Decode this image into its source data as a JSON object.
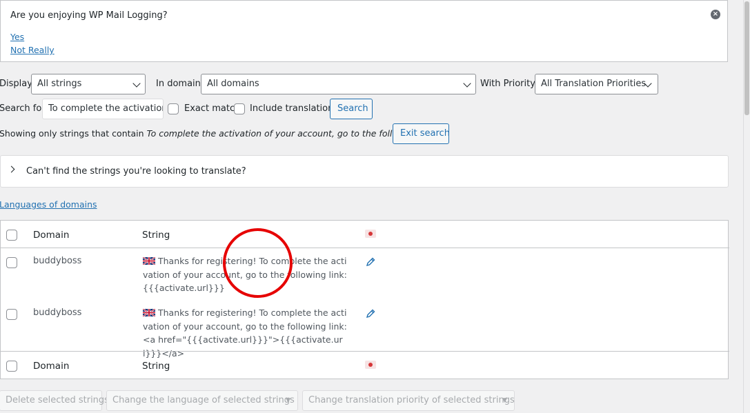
{
  "notice": {
    "question": "Are you enjoying WP Mail Logging?",
    "yes": "Yes",
    "no": "Not Really",
    "close_glyph": "×"
  },
  "filters": {
    "display_label": "Display:",
    "display_value": "All strings",
    "domain_label": "In domain:",
    "domain_value": "All domains",
    "priority_label": "With Priority:",
    "priority_value": "All Translation Priorities",
    "search_label": "Search for:",
    "search_value": "To complete the activation",
    "exact_match": "Exact match",
    "include_translations": "Include translations",
    "search_button": "Search"
  },
  "search_info": {
    "prefix": "Showing only strings that contain",
    "term": "To complete the activation of your account, go to the following link",
    "exit_button": "Exit search"
  },
  "accordion": {
    "title": "Can't find the strings you're looking to translate?"
  },
  "languages_link": "Languages of domains",
  "table": {
    "header": {
      "domain": "Domain",
      "string": "String"
    },
    "rows": [
      {
        "domain": "buddyboss",
        "string": "Thanks for registering! To complete the activation of your account, go to the following link: {{{activate.url}}}"
      },
      {
        "domain": "buddyboss",
        "string": "Thanks for registering! To complete the activation of your account, go to the following link: <a href=\"{{{activate.url}}}\">{{{activate.url}}}</a>"
      }
    ],
    "footer": {
      "domain": "Domain",
      "string": "String"
    }
  },
  "bulk": {
    "delete": "Delete selected strings",
    "change_language": "Change the language of selected strings",
    "change_priority": "Change translation priority of selected strings",
    "dropdown_glyph": "▼"
  },
  "colors": {
    "accent": "#2271b1",
    "annotation": "#e60000",
    "flag_dot": "#d63638"
  },
  "icons": [
    "close-icon",
    "chevron-down-icon",
    "chevron-right-icon",
    "uk-flag-icon",
    "pencil-icon",
    "language-flag-icon"
  ]
}
